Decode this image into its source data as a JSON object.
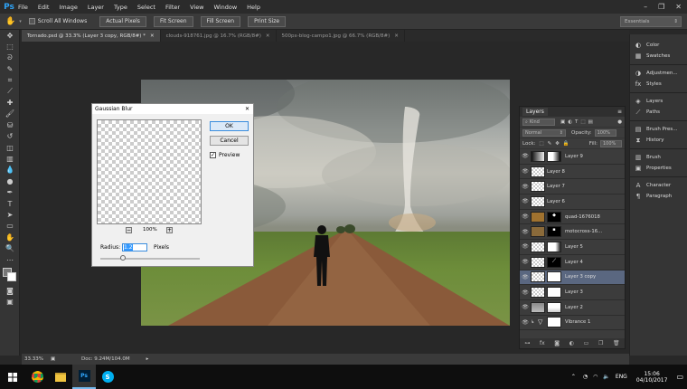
{
  "app": {
    "logo": "Ps",
    "menu": [
      "File",
      "Edit",
      "Image",
      "Layer",
      "Type",
      "Select",
      "Filter",
      "View",
      "Window",
      "Help"
    ],
    "window_controls": [
      "–",
      "❐",
      "✕"
    ]
  },
  "options_bar": {
    "scroll_all_windows": "Scroll All Windows",
    "buttons": [
      "Actual Pixels",
      "Fit Screen",
      "Fill Screen",
      "Print Size"
    ],
    "workspace": "Essentials"
  },
  "doc_tabs": [
    "Tornado.psd @ 33.3% (Layer 3 copy, RGB/8#) *",
    "clouds-918761.jpg @ 16.7% (RGB/8#)",
    "500px-blog-campo1.jpg @ 66.7% (RGB/8#)"
  ],
  "status": {
    "zoom": "33.33%",
    "doc": "Doc: 9.24M/104.0M"
  },
  "dialog": {
    "title": "Gaussian Blur",
    "ok": "OK",
    "cancel": "Cancel",
    "preview_label": "Preview",
    "preview_checked": true,
    "zoom": "100%",
    "radius_label": "Radius:",
    "radius_value": "1.2",
    "radius_unit": "Pixels"
  },
  "layers_panel": {
    "tab": "Layers",
    "filter": "Kind",
    "blend_mode": "Normal",
    "opacity_label": "Opacity:",
    "opacity_value": "100%",
    "lock_label": "Lock:",
    "fill_label": "Fill:",
    "fill_value": "100%",
    "layers": [
      {
        "name": "Layer 9",
        "mask": "gradient"
      },
      {
        "name": "Layer 8",
        "mask": "none"
      },
      {
        "name": "Layer 7",
        "mask": "none"
      },
      {
        "name": "Layer 6",
        "mask": "none"
      },
      {
        "name": "quad-1676018",
        "mask": "dark"
      },
      {
        "name": "motocross-16...",
        "mask": "dark"
      },
      {
        "name": "Layer 5",
        "mask": "light"
      },
      {
        "name": "Layer 4",
        "mask": "dark"
      },
      {
        "name": "Layer 3 copy",
        "mask": "white",
        "selected": true
      },
      {
        "name": "Layer 3",
        "mask": "white"
      },
      {
        "name": "Layer 2",
        "mask": "light"
      },
      {
        "name": "Vibrance 1",
        "mask": "white"
      }
    ]
  },
  "dock": {
    "groups": [
      [
        "Color",
        "Swatches"
      ],
      [
        "Adjustmen...",
        "Styles"
      ],
      [
        "Layers",
        "Paths"
      ],
      [
        "Brush Pres...",
        "History"
      ],
      [
        "Brush",
        "Properties"
      ],
      [
        "Character",
        "Paragraph"
      ]
    ]
  },
  "taskbar": {
    "language": "ENG",
    "time": "15:06",
    "date": "04/10/2017"
  },
  "colors": {
    "ps_blue": "#2fa3f6",
    "selection": "#5a6780"
  }
}
